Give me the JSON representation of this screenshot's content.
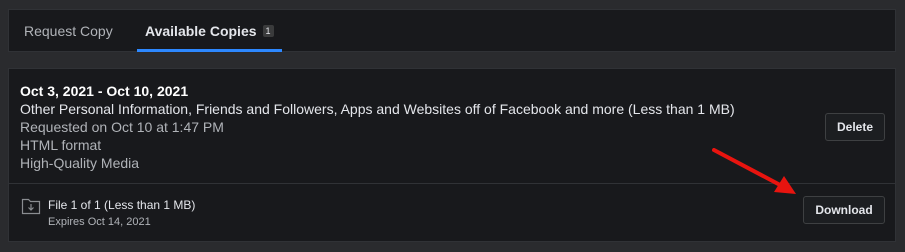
{
  "tabs": [
    {
      "label": "Request Copy"
    },
    {
      "label": "Available Copies",
      "count": "1"
    }
  ],
  "copy": {
    "date_range": "Oct 3, 2021 - Oct 10, 2021",
    "description": "Other Personal Information, Friends and Followers, Apps and Websites off of Facebook and more (Less than 1 MB)",
    "requested": "Requested on Oct 10 at 1:47 PM",
    "format": "HTML format",
    "media_quality": "High-Quality Media",
    "delete_label": "Delete"
  },
  "file": {
    "title": "File 1 of 1 (Less than 1 MB)",
    "expires": "Expires Oct 14, 2021",
    "download_label": "Download",
    "icon": "folder-download-icon"
  },
  "annotation": {
    "arrow_color": "#e8140f",
    "icon": "red-arrow-icon"
  }
}
